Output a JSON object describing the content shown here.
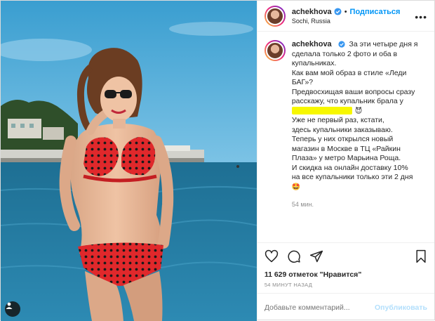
{
  "header": {
    "username": "achekhova",
    "follow_label": "Подписаться",
    "location": "Sochi, Russia",
    "more_label": "•••"
  },
  "caption": {
    "username": "achekhova",
    "lines": [
      "За эти четыре дня я",
      "сделала только 2 фото и оба в",
      "купальниках.",
      "Как вам мой образ в стиле «Леди",
      "БАГ»?",
      "Предвосхищая ваши вопросы сразу",
      "расскажу, что купальник брала у"
    ],
    "highlight_emoji": "😈",
    "lines2": [
      "Уже не первый раз, кстати,",
      "здесь купальники заказываю.",
      "Теперь у них открылся новый",
      "магазин в Москве в ТЦ «Райкин",
      "Плаза» у метро Марьина Роща.",
      "И скидка на онлайн доставку 10%",
      "на все купальники только эти 2 дня"
    ],
    "end_emoji": "🤩",
    "time": "54 мин."
  },
  "likes": "11 629 отметок \"Нравится\"",
  "posted": "54 МИНУТ НАЗАД",
  "comment_box": {
    "placeholder": "Добавьте комментарий...",
    "publish_label": "Опубликовать"
  },
  "icons": {
    "verified": "verified-badge-icon",
    "heart": "heart-icon",
    "comment": "comment-icon",
    "share": "share-icon",
    "save": "bookmark-icon",
    "load_more": "plus-circle-icon",
    "tag": "user-tag-icon"
  },
  "colors": {
    "accent": "#0095f6",
    "publish_disabled": "#b2dffc",
    "highlight": "#f7f700",
    "sea": "#2a8fc0",
    "swimsuit": "#e0282b"
  }
}
